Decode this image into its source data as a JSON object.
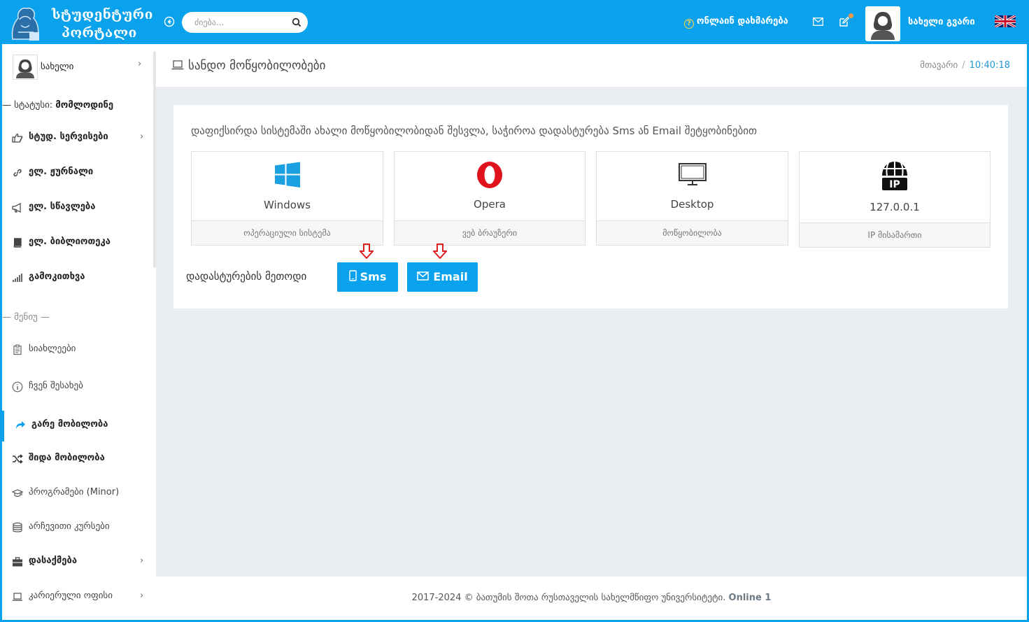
{
  "brand": {
    "line1": "სტუდენტური",
    "line2": "პორტალი"
  },
  "search": {
    "placeholder": "ძიება..."
  },
  "header": {
    "help_label": "ონლაინ დახმარება",
    "user_name": "სახელი გვარი",
    "language_icon": "uk-flag-icon"
  },
  "sidebar": {
    "profile_name": "სახელი",
    "status_label": "— სტატუსი:",
    "status_value": "მომლოდინე",
    "items": [
      {
        "label": "სტუდ. სერვისები",
        "icon": "hand-point-icon"
      },
      {
        "label": "ელ. ჟურნალი",
        "icon": "link-icon"
      },
      {
        "label": "ელ. სწავლება",
        "icon": "megaphone-icon"
      },
      {
        "label": "ელ. ბიბლიოთეკა",
        "icon": "book-icon"
      },
      {
        "label": "გამოკითხვა",
        "icon": "signal-bars-icon"
      }
    ],
    "section_label": "— მენიუ —",
    "menu": [
      {
        "label": "სიახლეები",
        "icon": "clipboard-icon"
      },
      {
        "label": "ჩვენ შესახებ",
        "icon": "info-icon"
      },
      {
        "label": "გარე მობილობა",
        "icon": "share-arrow-icon"
      },
      {
        "label": "შიდა მობილობა",
        "icon": "shuffle-icon"
      },
      {
        "label": "პროგრამები (Minor)",
        "icon": "graduation-cap-icon"
      },
      {
        "label": "არჩევითი კურსები",
        "icon": "database-icon"
      },
      {
        "label": "დასაქმება",
        "icon": "briefcase-icon"
      },
      {
        "label": "კარიერული ოფისი",
        "icon": "laptop-icon"
      }
    ]
  },
  "page": {
    "title": "სანდო მოწყობილობები",
    "breadcrumb_home": "მთავარი",
    "breadcrumb_sep": "/",
    "time": "10:40:18"
  },
  "panel": {
    "message": "დაფიქსირდა სისტემაში ახალი მოწყობილობიდან შესვლა, საჭიროა დადასტურება Sms ან Email შეტყობინებით",
    "cards": [
      {
        "value": "Windows",
        "caption": "ოპერაციული სისტემა",
        "icon": "windows-icon"
      },
      {
        "value": "Opera",
        "caption": "ვებ ბრაუზერი",
        "icon": "opera-icon"
      },
      {
        "value": "Desktop",
        "caption": "მოწყობილობა",
        "icon": "desktop-icon"
      },
      {
        "value": "127.0.0.1",
        "caption": "IP მისამართი",
        "icon": "ip-globe-icon"
      }
    ],
    "method_label": "დადასტურების მეთოდი",
    "sms_label": "Sms",
    "email_label": "Email"
  },
  "footer": {
    "text": "2017-2024 © ბათუმის შოთა რუსთაველის სახელმწიფო უნივერსიტეტი.",
    "online": "Online 1"
  },
  "colors": {
    "accent": "#0aa2ec",
    "arrow": "#e02020"
  }
}
